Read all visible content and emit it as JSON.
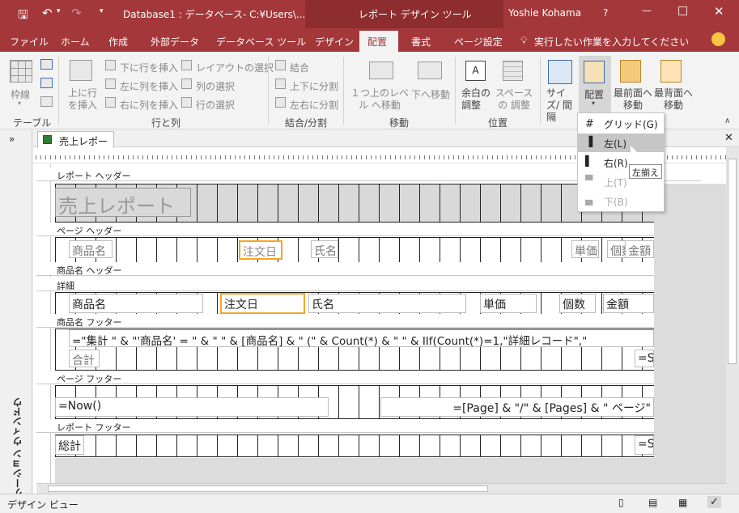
{
  "title": {
    "file": "Database1 : データベース- C:¥Users\\...",
    "tool": "レポート デザイン ツール",
    "user": "Yoshie Kohama",
    "help": "?"
  },
  "tabs": [
    "ファイル",
    "ホーム",
    "作成",
    "外部データ",
    "データベース ツール",
    "デザイン",
    "配置",
    "書式",
    "ページ設定"
  ],
  "tellme": "実行したい作業を入力してください",
  "ribbon": {
    "table": {
      "gridlines": "枠線",
      "label": "テーブル"
    },
    "rows": {
      "insert_above": "上に行を挿入",
      "insert_below": "下に行を挿入",
      "insert_left": "左に列を挿入",
      "insert_right": "右に列を挿入",
      "select_layout": "レイアウトの選択",
      "select_col": "列の選択",
      "select_row": "行の選択",
      "label": "行と列"
    },
    "merge": {
      "merge": "結合",
      "split_v": "上下に分割",
      "split_h": "左右に分割",
      "label": "結合/分割"
    },
    "move": {
      "up": "１つ上のレベル へ移動",
      "down": "下へ移動",
      "label": "移動"
    },
    "position": {
      "margins": "余白の 調整",
      "padding": "スペースの 調整",
      "label": "位置"
    },
    "sizing": {
      "size": "サイズ/ 間隔",
      "align": "配置",
      "front": "最前面へ 移動",
      "back": "最背面へ 移動"
    }
  },
  "nav_label": "ナビゲーション ウィンドウ",
  "doc_tab": "売上レポート",
  "sections": {
    "report_header": "レポート ヘッダー",
    "page_header": "ページ ヘッダー",
    "group_header": "商品名 ヘッダー",
    "detail": "詳細",
    "group_footer": "商品名 フッター",
    "page_footer": "ページ フッター",
    "report_footer": "レポート フッター"
  },
  "controls": {
    "report_title": "売上レポート",
    "ph_product": "商品名",
    "ph_date": "注文日",
    "ph_name": "氏名",
    "ph_price": "単価",
    "ph_qty": "個数",
    "ph_amount": "金額",
    "d_product": "商品名",
    "d_date": "注文日",
    "d_name": "氏名",
    "d_price": "単価",
    "d_qty": "個数",
    "d_amount": "金額",
    "gf_expr": "=\"集計 \" & \"'商品名' = \" & \" \" & [商品名] & \" (\" & Count(*) & \" \" & IIf(Count(*)=1,\"詳細レコード\",\"",
    "gf_total": "合計",
    "gf_sum": "=S",
    "pf_now": "=Now()",
    "pf_page": "=[Page] & \"/\" & [Pages] & \" ページ\"",
    "rf_total": "総計",
    "rf_sum": "=S"
  },
  "dropdown": {
    "grid": "グリッド(G)",
    "left": "左(L)",
    "right": "右(R)",
    "top": "上(T)",
    "bottom": "下(B)",
    "tooltip": "左揃え"
  },
  "status": "デザイン ビュー",
  "colors": {
    "title_bg": "#a4373a",
    "selection": "#f5a623",
    "highlight": "#c6c6c6"
  }
}
